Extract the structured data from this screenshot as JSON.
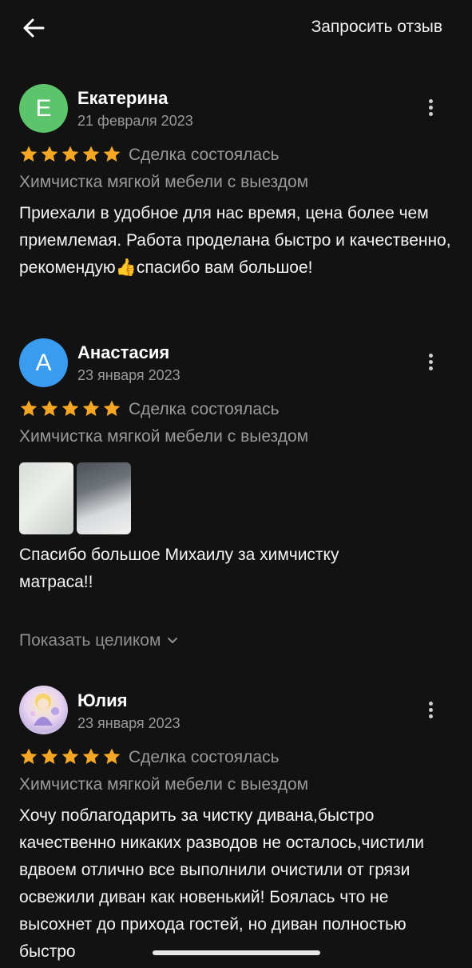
{
  "header": {
    "back_icon": "arrow-left-icon",
    "request_label": "Запросить отзыв"
  },
  "colors": {
    "background": "#121212",
    "star": "#f5a623",
    "avatar_green": "#5cc46b",
    "avatar_blue": "#3a9cf0",
    "muted_text": "#9a9a9a"
  },
  "reviews": [
    {
      "initial": "Е",
      "name": "Екатерина",
      "date": "21 февраля 2023",
      "rating": 5,
      "status": "Сделка состоялась",
      "service": "Химчистка мягкой мебели с выездом",
      "text": "Приехали в удобное для нас время, цена более чем приемлемая. Работа проделана быстро и качественно, рекомендую👍спасибо вам большое!"
    },
    {
      "initial": "А",
      "name": "Анастасия",
      "date": "23 января 2023",
      "rating": 5,
      "status": "Сделка состоялась",
      "service": "Химчистка мягкой мебели с выездом",
      "text": "Спасибо большое Михаилу за химчистку матраса!!",
      "show_all": "Показать целиком"
    },
    {
      "name": "Юлия",
      "date": "23 января 2023",
      "rating": 5,
      "status": "Сделка состоялась",
      "service": "Химчистка мягкой мебели с выездом",
      "text": "Хочу поблагодарить за чистку дивана,быстро качественно никаких разводов не осталось,чистили вдвоем отлично все выполнили очистили от грязи освежили диван как новенький! Боялась что не высохнет до прихода гостей, но диван полностью быстро"
    }
  ]
}
